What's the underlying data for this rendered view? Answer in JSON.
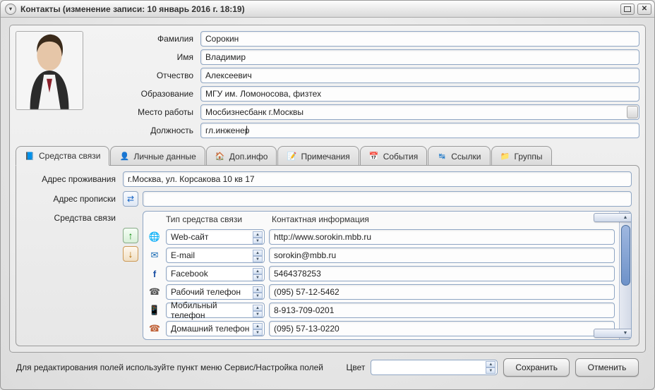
{
  "title": "Контакты  (изменение записи: 10 январь 2016 г. 18:19)",
  "fields": {
    "last_name": {
      "label": "Фамилия",
      "value": "Сорокин"
    },
    "first_name": {
      "label": "Имя",
      "value": "Владимир"
    },
    "patronymic": {
      "label": "Отчество",
      "value": "Алексеевич"
    },
    "education": {
      "label": "Образование",
      "value": "МГУ им. Ломоносова, физтех"
    },
    "workplace": {
      "label": "Место работы",
      "value": "Мосбизнесбанк г.Москвы"
    },
    "position": {
      "label": "Должность",
      "value": "гл.инженер"
    }
  },
  "tabs": [
    {
      "label": "Средства связи"
    },
    {
      "label": "Личные данные"
    },
    {
      "label": "Доп.инфо"
    },
    {
      "label": "Примечания"
    },
    {
      "label": "События"
    },
    {
      "label": "Ссылки"
    },
    {
      "label": "Группы"
    }
  ],
  "addr": {
    "residence": {
      "label": "Адрес проживания",
      "value": "г.Москва, ул. Корсакова 10 кв 17"
    },
    "registration": {
      "label": "Адрес прописки",
      "value": ""
    }
  },
  "comm": {
    "label": "Средства связи",
    "head_type": "Тип средства связи",
    "head_info": "Контактная информация",
    "rows": [
      {
        "icon": "globe",
        "type": "Web-сайт",
        "info": "http://www.sorokin.mbb.ru"
      },
      {
        "icon": "mail",
        "type": "E-mail",
        "info": "sorokin@mbb.ru"
      },
      {
        "icon": "fb",
        "type": "Facebook",
        "info": "5464378253"
      },
      {
        "icon": "phone",
        "type": "Рабочий телефон",
        "info": "(095) 57-12-5462"
      },
      {
        "icon": "mobile",
        "type": "Мобильный телефон",
        "info": "8-913-709-0201"
      },
      {
        "icon": "home",
        "type": "Домашний телефон",
        "info": "(095) 57-13-0220"
      }
    ]
  },
  "footer": {
    "hint": "Для редактирования полей используйте пункт меню Сервис/Настройка полей",
    "color_label": "Цвет",
    "save": "Сохранить",
    "cancel": "Отменить"
  }
}
